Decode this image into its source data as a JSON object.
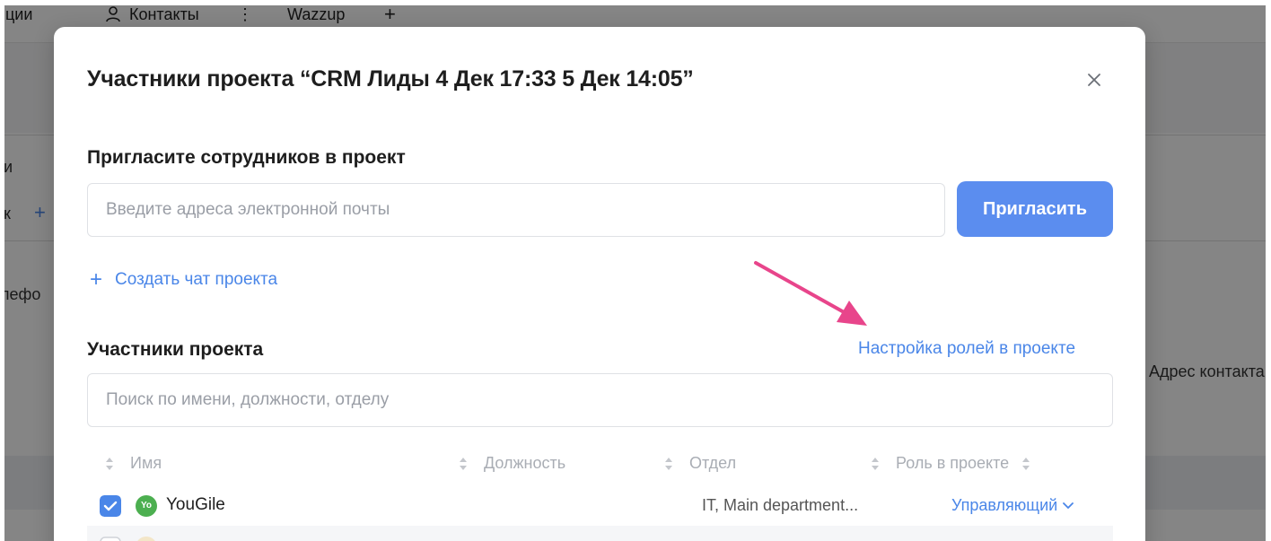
{
  "background": {
    "tabs": [
      {
        "label": "ции"
      },
      {
        "label": "Контакты"
      },
      {
        "label": "⋮"
      },
      {
        "label": "Wazzup"
      },
      {
        "label": "+"
      }
    ],
    "left_fragments": [
      "и",
      "к",
      "+",
      "лефо"
    ],
    "right_fragment": "Адрес контакта"
  },
  "modal": {
    "title": "Участники проекта “CRM Лиды 4 Дек 17:33 5 Дек 14:05”",
    "invite": {
      "heading": "Пригласите сотрудников в проект",
      "email_placeholder": "Введите адреса электронной почты",
      "email_value": "",
      "button_label": "Пригласить"
    },
    "create_chat": {
      "label": "Создать чат проекта"
    },
    "members": {
      "heading": "Участники проекта",
      "roles_link": "Настройка ролей в проекте",
      "search_placeholder": "Поиск по имени, должности, отделу",
      "search_value": "",
      "columns": [
        "Имя",
        "Должность",
        "Отдел",
        "Роль в проекте"
      ],
      "rows": [
        {
          "checked": true,
          "avatar_text": "Yo",
          "name": "YouGile",
          "position": "",
          "department": "IT, Main department...",
          "role": "Управляющий"
        }
      ]
    }
  },
  "colors": {
    "accent": "#5b8def",
    "link": "#4a86e8",
    "annotation_arrow": "#e8458b",
    "avatar_green": "#4caf50",
    "checkbox_checked": "#4a86e8"
  },
  "icons": {
    "close": "close-icon",
    "sort": "sort-icon",
    "chevron": "chevron-down-icon",
    "user": "user-icon",
    "plus": "plus-icon"
  }
}
